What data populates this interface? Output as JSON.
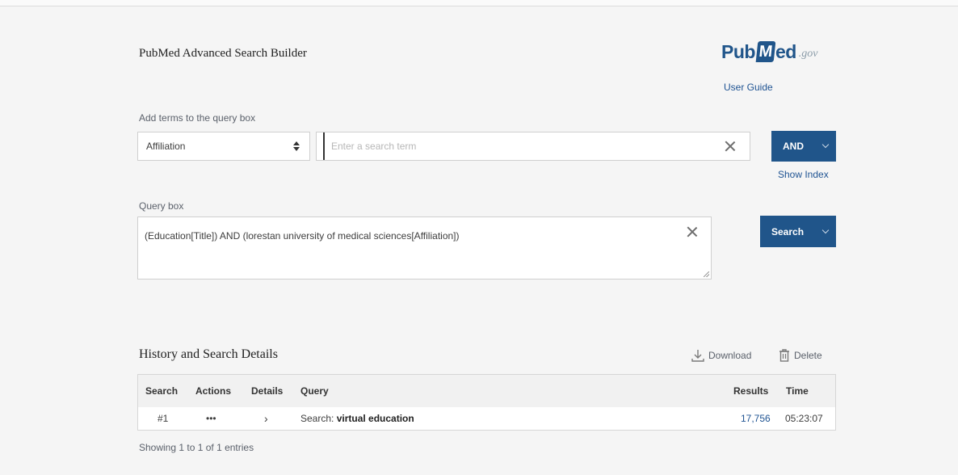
{
  "header": {
    "title": "PubMed Advanced Search Builder",
    "logo": {
      "part1": "Pub",
      "part2": "M",
      "part3": "ed",
      "suffix": ".gov"
    },
    "user_guide": "User Guide"
  },
  "builder": {
    "add_terms_label": "Add terms to the query box",
    "field_selected": "Affiliation",
    "term_placeholder": "Enter a search term",
    "operator_button": "AND",
    "show_index": "Show Index"
  },
  "query_box": {
    "label": "Query box",
    "value": "(Education[Title]) AND (lorestan university of medical sciences[Affiliation])",
    "search_button": "Search"
  },
  "history": {
    "title": "History and Search Details",
    "download": "Download",
    "delete": "Delete",
    "columns": {
      "search": "Search",
      "actions": "Actions",
      "details": "Details",
      "query": "Query",
      "results": "Results",
      "time": "Time"
    },
    "rows": [
      {
        "search": "#1",
        "actions": "•••",
        "details": "›",
        "query_prefix": "Search:",
        "query_terms": "virtual education",
        "results": "17,756",
        "time": "05:23:07"
      }
    ],
    "footer": "Showing 1 to 1 of 1 entries"
  },
  "colors": {
    "brand_blue": "#20558a",
    "link_blue": "#205493",
    "page_bg": "#f5f5f5"
  }
}
